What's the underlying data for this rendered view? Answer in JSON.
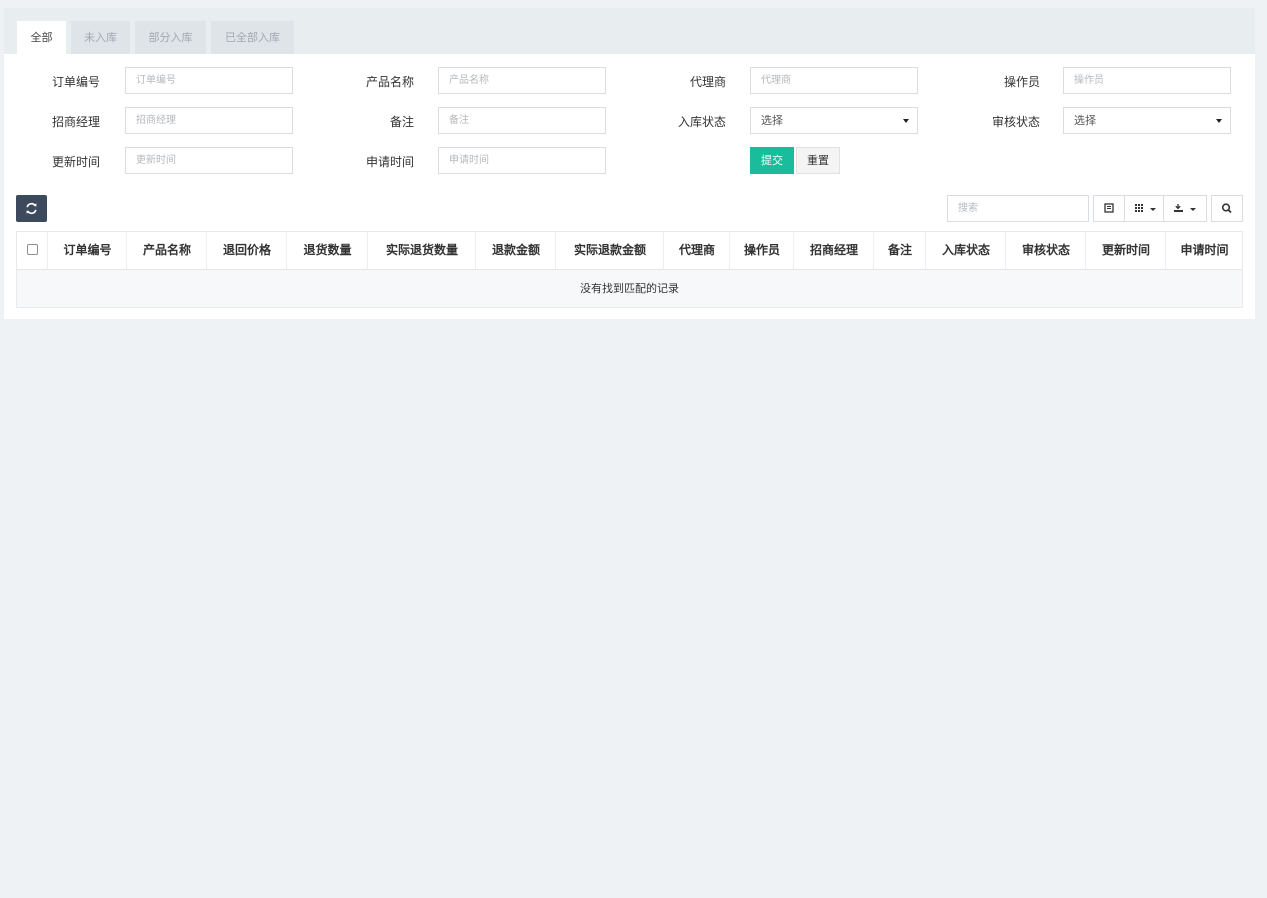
{
  "tabs": [
    {
      "label": "全部",
      "active": true
    },
    {
      "label": "未入库",
      "active": false
    },
    {
      "label": "部分入库",
      "active": false
    },
    {
      "label": "已全部入库",
      "active": false
    }
  ],
  "filters": {
    "order_no": {
      "label": "订单编号",
      "placeholder": "订单编号"
    },
    "product_name": {
      "label": "产品名称",
      "placeholder": "产品名称"
    },
    "agent": {
      "label": "代理商",
      "placeholder": "代理商"
    },
    "operator": {
      "label": "操作员",
      "placeholder": "操作员"
    },
    "manager": {
      "label": "招商经理",
      "placeholder": "招商经理"
    },
    "remark": {
      "label": "备注",
      "placeholder": "备注"
    },
    "stock_status": {
      "label": "入库状态",
      "value": "选择"
    },
    "audit_status": {
      "label": "审核状态",
      "value": "选择"
    },
    "update_time": {
      "label": "更新时间",
      "placeholder": "更新时间"
    },
    "apply_time": {
      "label": "申请时间",
      "placeholder": "申请时间"
    },
    "submit_label": "提交",
    "reset_label": "重置"
  },
  "toolbar": {
    "search_placeholder": "搜索"
  },
  "table": {
    "columns": [
      "订单编号",
      "产品名称",
      "退回价格",
      "退货数量",
      "实际退货数量",
      "退款金额",
      "实际退款金额",
      "代理商",
      "操作员",
      "招商经理",
      "备注",
      "入库状态",
      "审核状态",
      "更新时间",
      "申请时间"
    ],
    "empty_text": "没有找到匹配的记录"
  },
  "colors": {
    "submit": "#1abc9c",
    "refresh": "#3d4a5d",
    "background": "#eef2f5"
  }
}
